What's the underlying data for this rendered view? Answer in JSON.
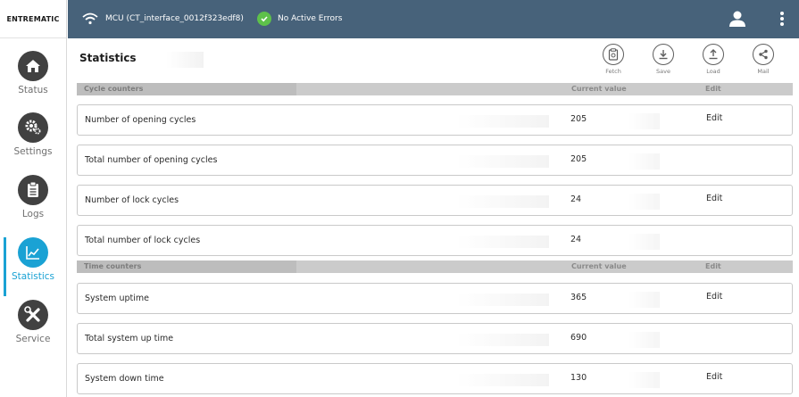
{
  "brand": {
    "name": "ENTREMATIC"
  },
  "topbar": {
    "connection": "MCU (CT_interface_0012f323edf8)",
    "error_status": "No Active Errors",
    "colors": {
      "bar": "#47627a",
      "ok": "#5ec14a"
    }
  },
  "sidebar": {
    "items": [
      {
        "label": "Status",
        "icon": "home-icon"
      },
      {
        "label": "Settings",
        "icon": "gears-icon"
      },
      {
        "label": "Logs",
        "icon": "clipboard-icon"
      },
      {
        "label": "Statistics",
        "icon": "chart-icon",
        "active": true
      },
      {
        "label": "Service",
        "icon": "wrench-screwdriver-icon"
      }
    ],
    "accent": "#1aa2d4"
  },
  "page": {
    "title": "Statistics"
  },
  "toolbar": {
    "fetch": "Fetch",
    "save": "Save",
    "load": "Load",
    "mail": "Mail"
  },
  "cycle_section": {
    "header": {
      "name": "Cycle counters",
      "value": "Current value",
      "edit": "Edit"
    },
    "rows": [
      {
        "name": "Number of opening cycles",
        "value": "205",
        "edit": "Edit"
      },
      {
        "name": "Total number of opening cycles",
        "value": "205",
        "edit": ""
      },
      {
        "name": "Number of lock cycles",
        "value": "24",
        "edit": "Edit"
      },
      {
        "name": "Total number of lock cycles",
        "value": "24",
        "edit": ""
      }
    ]
  },
  "time_section": {
    "header": {
      "name": "Time counters",
      "value": "Current value",
      "edit": "Edit"
    },
    "rows": [
      {
        "name": "System uptime",
        "value": "365",
        "edit": "Edit"
      },
      {
        "name": "Total system up time",
        "value": "690",
        "edit": ""
      },
      {
        "name": "System down time",
        "value": "130",
        "edit": "Edit"
      }
    ]
  }
}
